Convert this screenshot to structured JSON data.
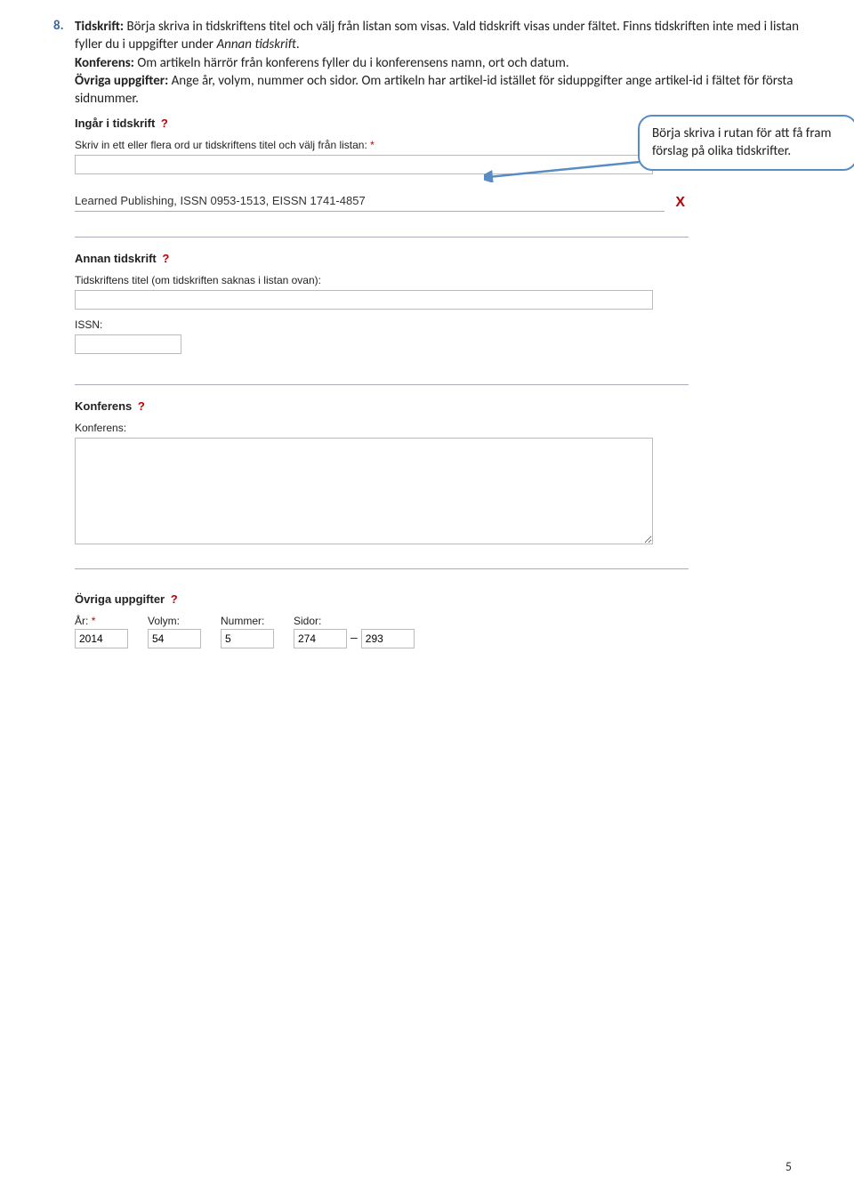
{
  "list": {
    "num": "8.",
    "text1a": "Tidskrift:",
    "text1b": " Börja skriva in tidskriftens titel och välj från listan som visas. Vald tidskrift visas under fältet. Finns tidskriften inte med i listan fyller du i uppgifter under ",
    "text1c": "Annan tidskrift",
    "text1d": ".",
    "text2a": "Konferens:",
    "text2b": " Om artikeln härrör från konferens fyller du i konferensens namn, ort och datum.",
    "text3a": "Övriga uppgifter:",
    "text3b": " Ange år, volym, nummer och sidor. Om artikeln har artikel-id istället för siduppgifter ange artikel-id i fältet för första sidnummer."
  },
  "callout": "Börja skriva i rutan för att få fram förslag på olika tidskrifter.",
  "ingar": {
    "heading": "Ingår i tidskrift",
    "label": "Skriv in ett eller flera ord ur tidskriftens titel och välj från listan:",
    "selected": "Learned Publishing, ISSN 0953-1513, EISSN 1741-4857"
  },
  "annan": {
    "heading": "Annan tidskrift",
    "l1": "Tidskriftens titel (om tidskriften saknas i listan ovan):",
    "l2": "ISSN:"
  },
  "konf": {
    "heading": "Konferens",
    "l1": "Konferens:"
  },
  "ovriga": {
    "heading": "Övriga uppgifter",
    "ar_label": "År:",
    "ar": "2014",
    "vol_label": "Volym:",
    "vol": "54",
    "num_label": "Nummer:",
    "num": "5",
    "sid_label": "Sidor:",
    "sid1": "274",
    "sid2": "293"
  },
  "page_num": "5",
  "qmark": "?",
  "star": "*",
  "x": "X",
  "dash": "–"
}
